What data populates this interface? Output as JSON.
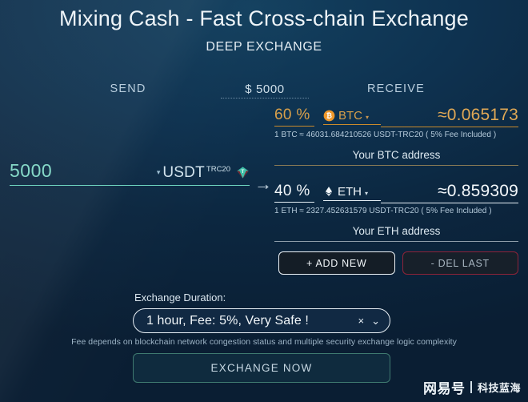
{
  "header": {
    "title": "Mixing Cash - Fast Cross-chain Exchange",
    "subtitle": "DEEP EXCHANGE"
  },
  "columns": {
    "send_label": "SEND",
    "amount_label": "$ 5000",
    "receive_label": "RECEIVE"
  },
  "send": {
    "amount": "5000",
    "caret": "▾",
    "currency": "USDT",
    "network_sup": "TRC20",
    "token_icon": "usdt-token-icon"
  },
  "arrow": "→",
  "receive": {
    "rows": [
      {
        "percent": "60 %",
        "symbol": "BTC",
        "caret": "▾",
        "icon": "bitcoin-icon",
        "amount": "≈0.065173",
        "rate": "1 BTC ≈ 46031.684210526 USDT-TRC20 ( 5% Fee Included )",
        "address_placeholder": "Your BTC address",
        "address_value": "",
        "accent": "#d9a04a"
      },
      {
        "percent": "40 %",
        "symbol": "ETH",
        "caret": "▾",
        "icon": "ethereum-icon",
        "amount": "≈0.859309",
        "rate": "1 ETH ≈ 2327.452631579 USDT-TRC20 ( 5% Fee Included )",
        "address_placeholder": "Your ETH address",
        "address_value": "",
        "accent": "#f2f7fa"
      }
    ]
  },
  "actions": {
    "add_label": "+ ADD NEW",
    "del_label": "- DEL LAST"
  },
  "duration": {
    "label": "Exchange Duration:",
    "selected": "1 hour, Fee: 5%, Very Safe !",
    "clear_icon": "×",
    "caret_icon": "⌄",
    "note": "Fee depends on blockchain network congestion status and multiple security exchange logic complexity"
  },
  "submit": {
    "label": "EXCHANGE NOW"
  },
  "watermark": {
    "main": "网易号",
    "sub": "科技蓝海"
  }
}
